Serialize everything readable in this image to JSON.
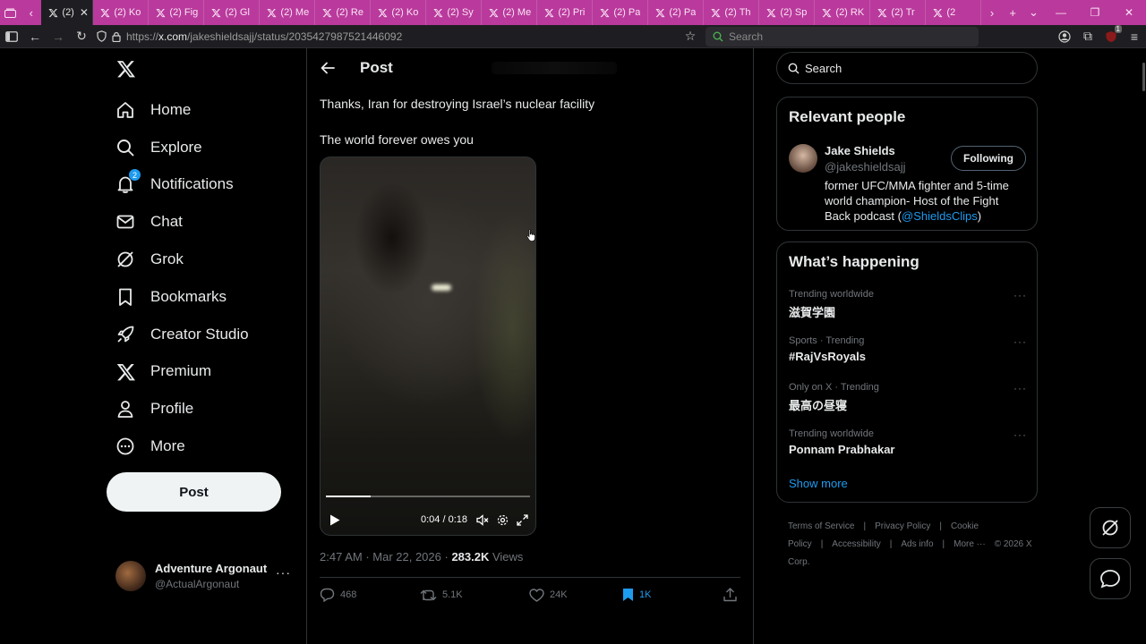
{
  "browser": {
    "tabs": [
      {
        "title": "(2)",
        "active": true
      },
      {
        "title": "(2) Ko"
      },
      {
        "title": "(2) Fig"
      },
      {
        "title": "(2) Gl"
      },
      {
        "title": "(2) Me"
      },
      {
        "title": "(2) Re"
      },
      {
        "title": "(2) Ko"
      },
      {
        "title": "(2) Sy"
      },
      {
        "title": "(2) Me"
      },
      {
        "title": "(2) Pri"
      },
      {
        "title": "(2) Pa"
      },
      {
        "title": "(2) Pa"
      },
      {
        "title": "(2) Th"
      },
      {
        "title": "(2) Sp"
      },
      {
        "title": "(2) RK"
      },
      {
        "title": "(2) Tr"
      },
      {
        "title": "(2"
      }
    ],
    "url_prefix": "https://",
    "url_host": "x.com",
    "url_path": "/jakeshieldsajj/status/2035427987521446092",
    "search_placeholder": "Search",
    "notif_count": "1"
  },
  "sidebar": {
    "items": [
      {
        "label": "Home",
        "icon": "home-icon"
      },
      {
        "label": "Explore",
        "icon": "search-icon"
      },
      {
        "label": "Notifications",
        "icon": "bell-icon",
        "badge": "2"
      },
      {
        "label": "Chat",
        "icon": "mail-icon"
      },
      {
        "label": "Grok",
        "icon": "grok-icon"
      },
      {
        "label": "Bookmarks",
        "icon": "bookmark-icon"
      },
      {
        "label": "Creator Studio",
        "icon": "rocket-icon"
      },
      {
        "label": "Premium",
        "icon": "x-icon"
      },
      {
        "label": "Profile",
        "icon": "person-icon"
      },
      {
        "label": "More",
        "icon": "more-circle-icon"
      }
    ],
    "post_label": "Post",
    "account": {
      "name": "Adventure Argonaut",
      "handle": "@ActualArgonaut"
    }
  },
  "post": {
    "header_title": "Post",
    "line1": "Thanks, Iran for destroying Israel’s nuclear facility",
    "line2": "The world forever owes you",
    "video": {
      "time": "0:04 / 0:18",
      "progress": 0.22
    },
    "meta": {
      "time": "2:47 AM",
      "date": "Mar 22, 2026",
      "views": "283.2K",
      "views_label": "Views"
    },
    "actions": {
      "replies": "468",
      "reposts": "5.1K",
      "likes": "24K",
      "bookmarks": "1K"
    }
  },
  "right": {
    "search_placeholder": "Search",
    "relevant": {
      "title": "Relevant people",
      "name": "Jake Shields",
      "handle": "@jakeshieldsajj",
      "follow_label": "Following",
      "bio_text": "former UFC/MMA fighter and 5-time world champion- Host of the Fight Back podcast (",
      "bio_mention": "@ShieldsClips",
      "bio_end": ")"
    },
    "happening": {
      "title": "What’s happening",
      "trends": [
        {
          "context": "Trending worldwide",
          "name": "滋賀学園"
        },
        {
          "context": "Sports · Trending",
          "name": "#RajVsRoyals"
        },
        {
          "context": "Only on X · Trending",
          "name": "最高の昼寝"
        },
        {
          "context": "Trending worldwide",
          "name": "Ponnam Prabhakar"
        }
      ],
      "show_more": "Show more"
    },
    "footer": [
      "Terms of Service",
      "|",
      "Privacy Policy",
      "|",
      "Cookie Policy",
      "|",
      "Accessibility",
      "|",
      "Ads info",
      "|",
      "More ···",
      "© 2026 X Corp."
    ]
  },
  "colors": {
    "accent": "#1d9bf0",
    "tabbar": "#b93a9c",
    "background": "#000000",
    "border": "#2f3336"
  }
}
